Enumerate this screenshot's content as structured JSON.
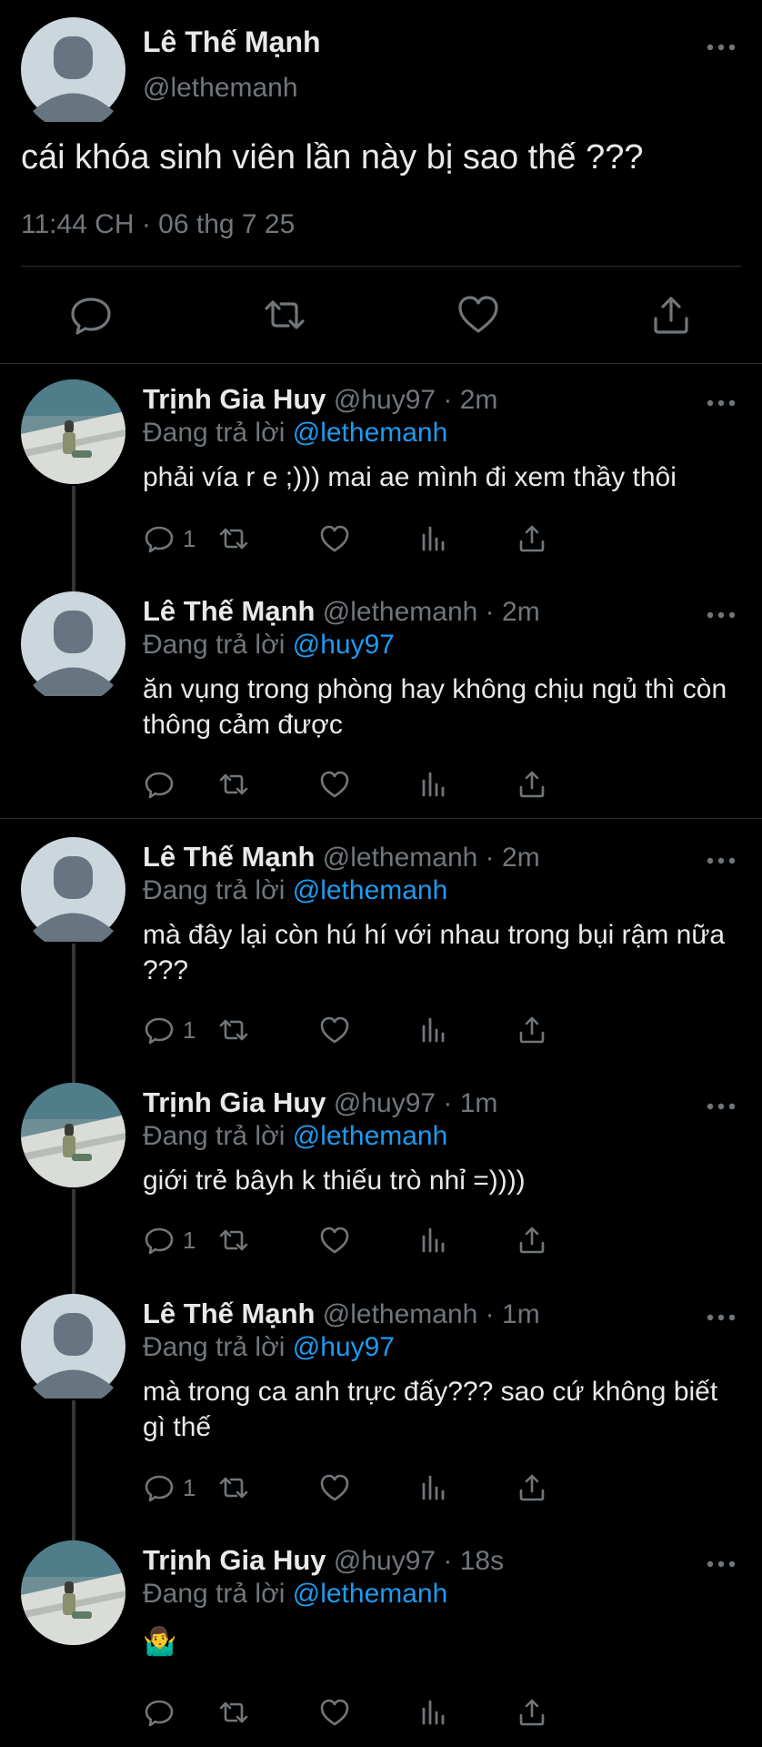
{
  "main_tweet": {
    "author_name": "Lê Thế Mạnh",
    "author_handle": "@lethemanh",
    "text": "cái khóa sinh viên lần này bị sao thế ???",
    "timestamp": "11:44 CH · 06 thg 7 25",
    "actions": [
      "reply-icon",
      "retweet-icon",
      "like-icon",
      "share-icon"
    ]
  },
  "replies": [
    {
      "author_name": "Trịnh Gia Huy",
      "meta": "@huy97 · 2m",
      "replying_prefix": "Đang trả lời",
      "replying_to": "@lethemanh",
      "text": "phải vía r e ;))) mai ae mình đi xem thầy thôi",
      "reply_count": "1",
      "avatar": "photo"
    },
    {
      "author_name": "Lê Thế Mạnh",
      "meta": "@lethemanh · 2m",
      "replying_prefix": "Đang trả lời",
      "replying_to": "@huy97",
      "text": "ăn vụng trong phòng hay không chịu ngủ thì còn thông cảm được",
      "reply_count": "",
      "avatar": "default"
    },
    {
      "author_name": "Lê Thế Mạnh",
      "meta": "@lethemanh · 2m",
      "replying_prefix": "Đang trả lời",
      "replying_to": "@lethemanh",
      "text": "mà đây lại còn hú hí với nhau trong bụi rậm nữa ???",
      "reply_count": "1",
      "avatar": "default"
    },
    {
      "author_name": "Trịnh Gia Huy",
      "meta": "@huy97 · 1m",
      "replying_prefix": "Đang trả lời",
      "replying_to": "@lethemanh",
      "text": "giới trẻ bâyh k thiếu trò nhỉ =))))",
      "reply_count": "1",
      "avatar": "photo"
    },
    {
      "author_name": "Lê Thế Mạnh",
      "meta": "@lethemanh · 1m",
      "replying_prefix": "Đang trả lời",
      "replying_to": "@huy97",
      "text": "mà trong ca anh trực đấy??? sao cứ không biết gì thế",
      "reply_count": "1",
      "avatar": "default"
    },
    {
      "author_name": "Trịnh Gia Huy",
      "meta": "@huy97 · 18s",
      "replying_prefix": "Đang trả lời",
      "replying_to": "@lethemanh",
      "text": "🤷‍♂️",
      "reply_count": "",
      "avatar": "photo"
    }
  ],
  "colors": {
    "background": "#000000",
    "text": "#e7e9ea",
    "muted": "#71767b",
    "link": "#1d9bf0",
    "divider": "#2f3336"
  }
}
